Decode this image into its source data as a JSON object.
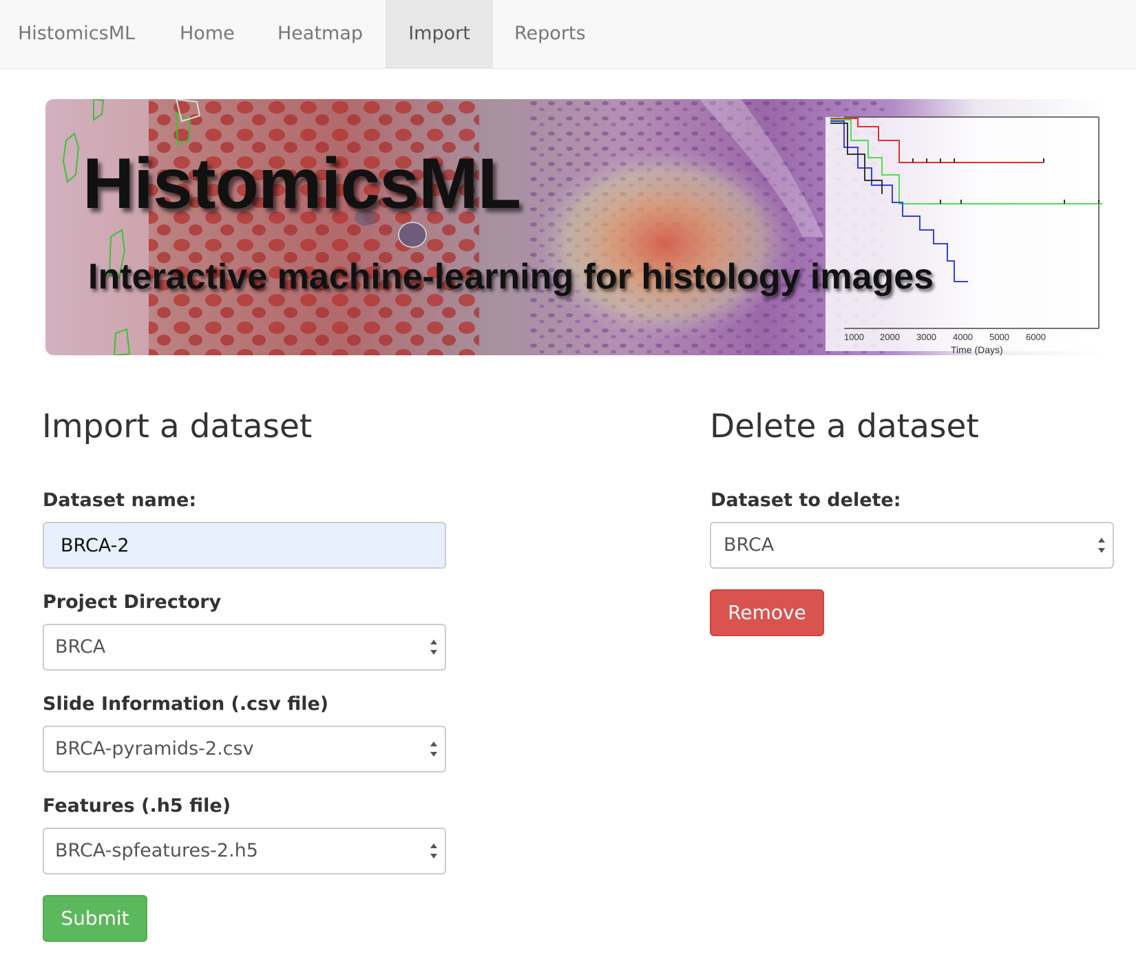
{
  "navbar": {
    "brand": "HistomicsML",
    "items": [
      {
        "label": "Home",
        "active": false
      },
      {
        "label": "Heatmap",
        "active": false
      },
      {
        "label": "Import",
        "active": true
      },
      {
        "label": "Reports",
        "active": false
      }
    ]
  },
  "banner": {
    "title": "HistomicsML",
    "subtitle": "Interactive machine-learning for histology images",
    "plot": {
      "x_ticks": [
        "1000",
        "2000",
        "3000",
        "4000",
        "5000",
        "6000"
      ],
      "x_label": "Time (Days)",
      "series_colors": [
        "#e0302e",
        "#4ee04a",
        "#2f3fe6",
        "#333333"
      ]
    }
  },
  "import_section": {
    "title": "Import a dataset",
    "dataset_name_label": "Dataset name:",
    "dataset_name_value": "BRCA-2",
    "project_dir_label": "Project Directory",
    "project_dir_value": "BRCA",
    "slide_info_label": "Slide Information (.csv file)",
    "slide_info_value": "BRCA-pyramids-2.csv",
    "features_label": "Features (.h5 file)",
    "features_value": "BRCA-spfeatures-2.h5",
    "submit_label": "Submit"
  },
  "delete_section": {
    "title": "Delete a dataset",
    "dataset_label": "Dataset to delete:",
    "dataset_value": "BRCA",
    "remove_label": "Remove"
  },
  "colors": {
    "navbar_bg": "#f8f8f8",
    "nav_active_bg": "#e7e7e7",
    "danger": "#d9534f",
    "success": "#5cb85c",
    "autofill_bg": "#e8f0fe"
  }
}
